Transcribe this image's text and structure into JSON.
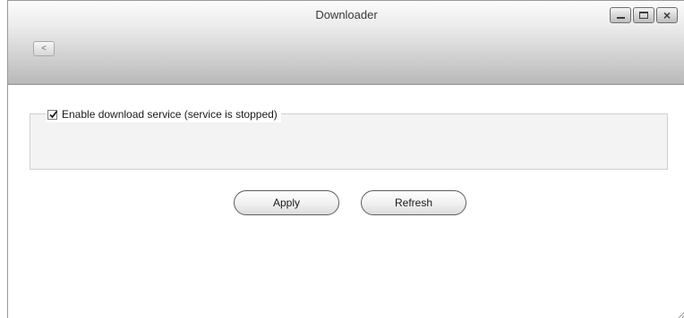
{
  "window": {
    "title": "Downloader"
  },
  "toolbar": {
    "back_label": "<",
    "back_icon": "chevron-left-icon"
  },
  "window_controls": {
    "minimize_icon": "minimize-icon",
    "maximize_icon": "maximize-icon",
    "close_icon": "close-icon"
  },
  "service": {
    "enabled": true,
    "label": "Enable download service (service is stopped)"
  },
  "actions": {
    "apply_label": "Apply",
    "refresh_label": "Refresh"
  },
  "colors": {
    "titlebar_top": "#fbfbfb",
    "titlebar_bottom": "#b9b9b9",
    "fieldset_bg": "#f3f3f3"
  }
}
